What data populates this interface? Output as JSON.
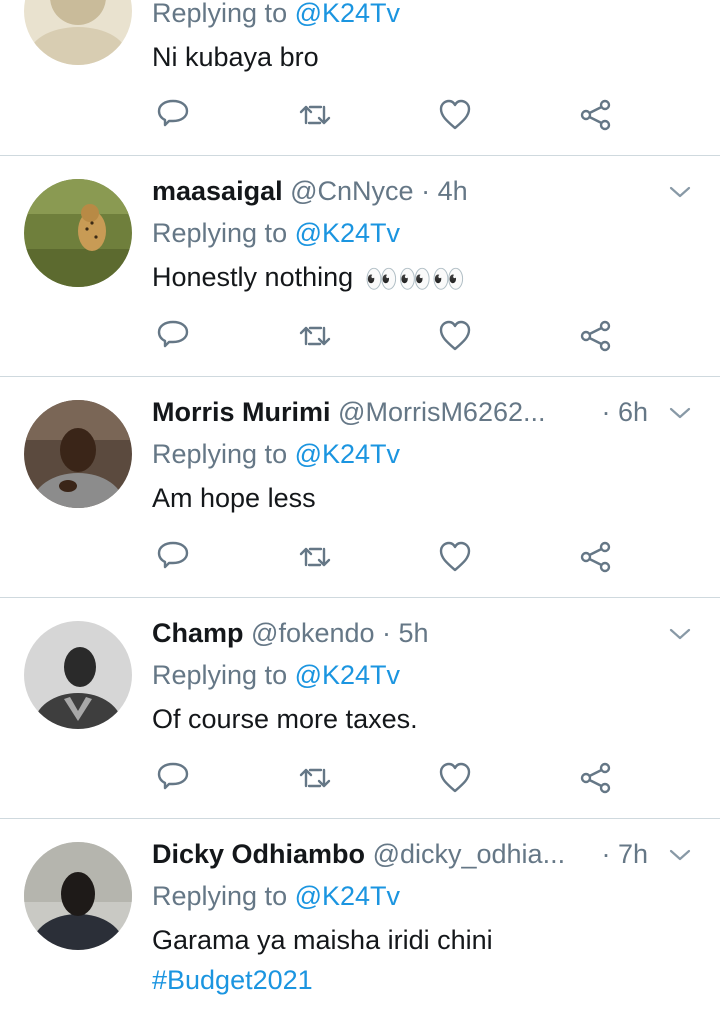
{
  "tweets": [
    {
      "name": "",
      "handle": "",
      "time": "",
      "replying_prefix": "Replying to",
      "replying_to": "@K24Tv",
      "text": "Ni kubaya bro"
    },
    {
      "name": "maasaigal",
      "handle": "@CnNyce",
      "time": "· 4h",
      "replying_prefix": "Replying to",
      "replying_to": "@K24Tv",
      "text": "Honestly nothing",
      "emoji": "👀👀👀"
    },
    {
      "name": "Morris Murimi",
      "handle": "@MorrisM6262...",
      "time": "· 6h",
      "replying_prefix": "Replying to",
      "replying_to": "@K24Tv",
      "text": "Am hope less"
    },
    {
      "name": "Champ",
      "handle": "@fokendo",
      "time": "· 5h",
      "replying_prefix": "Replying to",
      "replying_to": "@K24Tv",
      "text": "Of course more taxes."
    },
    {
      "name": "Dicky Odhiambo",
      "handle": "@dicky_odhia...",
      "time": "· 7h",
      "replying_prefix": "Replying to",
      "replying_to": "@K24Tv",
      "text": "Garama ya maisha iridi chini",
      "hashtag": "#Budget2021"
    }
  ],
  "icons": {
    "reply": "reply-icon",
    "retweet": "retweet-icon",
    "like": "like-icon",
    "share": "share-icon",
    "caret": "chevron-down-icon"
  },
  "colors": {
    "link": "#1b95e0",
    "text": "#14171a",
    "muted": "#657786",
    "divider": "#cfd9de"
  }
}
